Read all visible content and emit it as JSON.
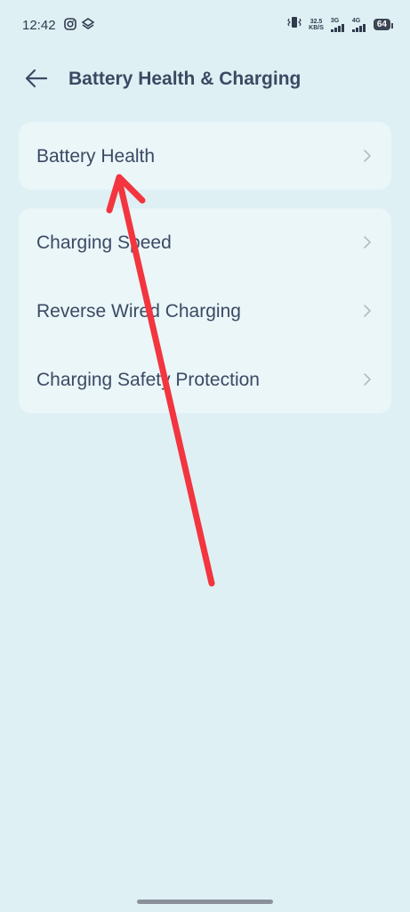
{
  "status_bar": {
    "time": "12:42",
    "net_speed_value": "32.5",
    "net_speed_unit": "KB/S",
    "sig1_label": "3G",
    "sig2_label": "4G",
    "battery_level": "64"
  },
  "header": {
    "title": "Battery Health & Charging"
  },
  "settings": {
    "group1": [
      {
        "label": "Battery Health"
      }
    ],
    "group2": [
      {
        "label": "Charging Speed"
      },
      {
        "label": "Reverse Wired Charging"
      },
      {
        "label": "Charging Safety Protection"
      }
    ]
  },
  "colors": {
    "background": "#dff0f4",
    "card": "#eaf6f8",
    "text": "#3b4a63",
    "annotation_arrow": "#f2353f"
  }
}
